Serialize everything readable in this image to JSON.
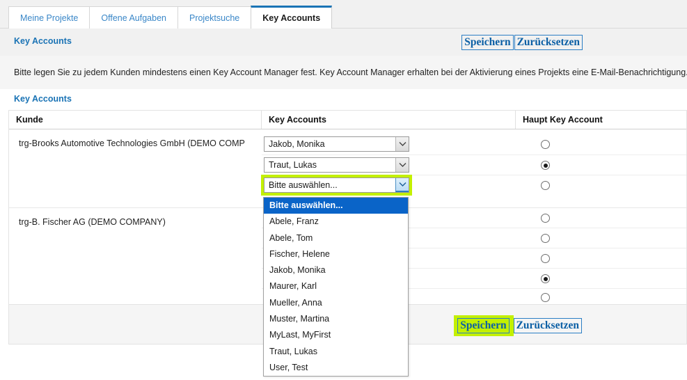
{
  "tabs": [
    {
      "label": "Meine Projekte",
      "active": false
    },
    {
      "label": "Offene Aufgaben",
      "active": false
    },
    {
      "label": "Projektsuche",
      "active": false
    },
    {
      "label": "Key Accounts",
      "active": true
    }
  ],
  "header": {
    "title": "Key Accounts",
    "save_label": "Speichern",
    "reset_label": "Zurücksetzen"
  },
  "info": {
    "text": "Bitte legen Sie zu jedem Kunden mindestens einen Key Account Manager fest. Key Account Manager erhalten bei der Aktivierung eines Projekts eine E-Mail-Benachrichtigung."
  },
  "section": {
    "title": "Key Accounts"
  },
  "table": {
    "columns": [
      "Kunde",
      "Key Accounts",
      "Haupt Key Account"
    ],
    "groups": [
      {
        "customer": "trg-Brooks Automotive Technologies GmbH (DEMO COMP",
        "rows": [
          {
            "key_account": "Jakob, Monika",
            "main": false,
            "open": false
          },
          {
            "key_account": "Traut, Lukas",
            "main": true,
            "open": false
          },
          {
            "key_account": "Bitte auswählen...",
            "main": false,
            "open": true
          }
        ]
      },
      {
        "customer": "trg-B. Fischer AG (DEMO COMPANY)",
        "rows": [
          {
            "key_account": "",
            "main": false,
            "open": false
          },
          {
            "key_account": "",
            "main": false,
            "open": false
          },
          {
            "key_account": "",
            "main": false,
            "open": false
          },
          {
            "key_account": "",
            "main": true,
            "open": false
          },
          {
            "key_account": "",
            "main": false,
            "open": false
          }
        ]
      }
    ]
  },
  "footer": {
    "save_label": "Speichern",
    "reset_label": "Zurücksetzen"
  },
  "dropdown": {
    "options": [
      "Bitte auswählen...",
      "Abele, Franz",
      "Abele, Tom",
      "Fischer, Helene",
      "Jakob, Monika",
      "Maurer, Karl",
      "Mueller, Anna",
      "Muster, Martina",
      "MyLast, MyFirst",
      "Traut, Lukas",
      "User, Test"
    ],
    "selected_index": 0
  },
  "colors": {
    "accent_blue": "#1a73b5",
    "link_blue": "#0b5fa5",
    "highlight_green": "#c3f000",
    "selection_blue": "#0a64c8"
  }
}
